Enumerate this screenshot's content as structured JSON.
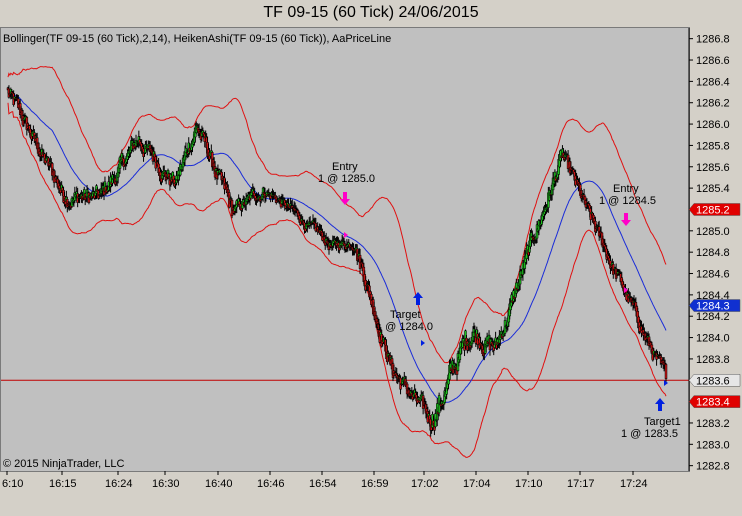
{
  "chart_data": {
    "type": "candlestick",
    "title": "TF 09-15 (60 Tick)  24/06/2015",
    "indicator_caption": "Bollinger(TF 09-15 (60 Tick),2,14), HeikenAshi(TF 09-15 (60 Tick)), AaPriceLine",
    "copyright": "© 2015 NinjaTrader, LLC",
    "x_tick_labels": [
      "6:10",
      "16:15",
      "16:24",
      "16:30",
      "16:40",
      "16:46",
      "16:54",
      "16:59",
      "17:02",
      "17:04",
      "17:10",
      "17:17",
      "17:24"
    ],
    "y_ticks": [
      "1282.8",
      "1283.0",
      "1283.2",
      "1283.4",
      "1283.6",
      "1283.8",
      "1284.0",
      "1284.2",
      "1284.4",
      "1284.6",
      "1284.8",
      "1285.0",
      "1285.2",
      "1285.4",
      "1285.6",
      "1285.8",
      "1286.0",
      "1286.2",
      "1286.4",
      "1286.6",
      "1286.8"
    ],
    "ylim": [
      1282.75,
      1286.9
    ],
    "price_levels": [
      {
        "value": 1285.2,
        "label": "1285.2",
        "color": "#e00000",
        "text_color": "#ffffff",
        "role": "upper"
      },
      {
        "value": 1284.3,
        "label": "1284.3",
        "color": "#1030d0",
        "text_color": "#ffffff",
        "role": "middle"
      },
      {
        "value": 1283.6,
        "label": "1283.6",
        "color": "#e6e6e6",
        "text_color": "#000000",
        "role": "last"
      },
      {
        "value": 1283.4,
        "label": "1283.4",
        "color": "#e00000",
        "text_color": "#ffffff",
        "role": "lower"
      }
    ],
    "price_line": 1283.6,
    "up_color": "#1fc01f",
    "down_color": "#c81414",
    "band_color": "#e01010",
    "middle_color": "#1a2cd8",
    "line_color": "#c00000",
    "segments": [
      {
        "n": 60,
        "from": 1286.3,
        "to": 1285.35,
        "vol": 0.1
      },
      {
        "n": 40,
        "from": 1285.35,
        "to": 1285.3,
        "vol": 0.1
      },
      {
        "n": 40,
        "from": 1285.3,
        "to": 1285.85,
        "vol": 0.1
      },
      {
        "n": 40,
        "from": 1285.85,
        "to": 1285.45,
        "vol": 0.1
      },
      {
        "n": 22,
        "from": 1285.45,
        "to": 1286.0,
        "vol": 0.1
      },
      {
        "n": 38,
        "from": 1286.0,
        "to": 1285.15,
        "vol": 0.1
      },
      {
        "n": 35,
        "from": 1285.15,
        "to": 1285.4,
        "vol": 0.08
      },
      {
        "n": 70,
        "from": 1285.4,
        "to": 1284.85,
        "vol": 0.06
      },
      {
        "n": 25,
        "from": 1284.85,
        "to": 1284.9,
        "vol": 0.06
      },
      {
        "n": 40,
        "from": 1284.9,
        "to": 1283.7,
        "vol": 0.1
      },
      {
        "n": 40,
        "from": 1283.7,
        "to": 1283.2,
        "vol": 0.1
      },
      {
        "n": 45,
        "from": 1283.2,
        "to": 1284.1,
        "vol": 0.14
      },
      {
        "n": 25,
        "from": 1284.1,
        "to": 1283.9,
        "vol": 0.12
      },
      {
        "n": 70,
        "from": 1283.9,
        "to": 1285.7,
        "vol": 0.1
      },
      {
        "n": 30,
        "from": 1285.7,
        "to": 1285.1,
        "vol": 0.08
      },
      {
        "n": 30,
        "from": 1285.1,
        "to": 1284.55,
        "vol": 0.08
      },
      {
        "n": 50,
        "from": 1284.55,
        "to": 1283.6,
        "vol": 0.08
      }
    ],
    "annotations": [
      {
        "name": "entry-1",
        "lines": [
          "Entry",
          "1 @ 1285.0"
        ],
        "marker": "down-arrow",
        "color": "#ff00c8"
      },
      {
        "name": "target-1",
        "lines": [
          "Target",
          "1 @ 1284.0"
        ],
        "marker": "up-arrow",
        "color": "#0020e0"
      },
      {
        "name": "entry-2",
        "lines": [
          "Entry",
          "1 @ 1284.5"
        ],
        "marker": "down-arrow",
        "color": "#ff00c8"
      },
      {
        "name": "target-2",
        "lines": [
          "Target1",
          "1 @ 1283.5"
        ],
        "marker": "up-arrow",
        "color": "#0020e0"
      }
    ]
  }
}
